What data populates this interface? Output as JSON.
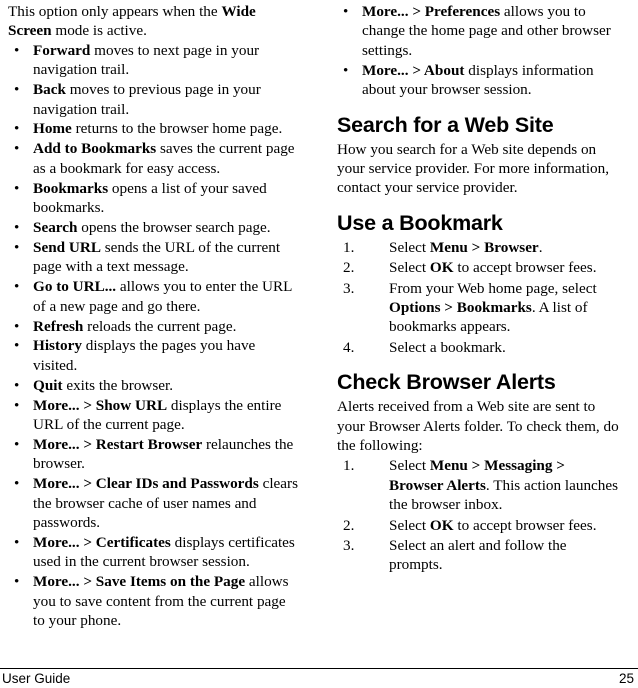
{
  "document": {
    "footer": {
      "left_label": "User Guide",
      "page_number": "25"
    }
  },
  "left_column": {
    "intro_paragraph": {
      "plain_before": "This option only appears when the ",
      "bold": "Wide Screen",
      "plain_after": " mode is active."
    },
    "bullet_marker": "•",
    "bullets": [
      {
        "term": "Forward",
        "rest": " moves to next page in your navigation trail."
      },
      {
        "term": "Back",
        "rest": " moves to previous page in your navigation trail."
      },
      {
        "term": "Home",
        "rest": " returns to the browser home page."
      },
      {
        "term": "Add to Bookmarks",
        "rest": " saves the current page as a bookmark for easy access."
      },
      {
        "term": "Bookmarks",
        "rest": " opens a list of your saved bookmarks."
      },
      {
        "term": "Search",
        "rest": " opens the browser search page."
      },
      {
        "term": "Send URL",
        "rest": " sends the URL of the current page with a text message."
      },
      {
        "term": "Go to URL...",
        "rest": " allows you to enter the URL of a new page and go there."
      },
      {
        "term": "Refresh",
        "rest": " reloads the current page."
      },
      {
        "term": "History",
        "rest": " displays the pages you have visited."
      },
      {
        "term": "Quit",
        "rest": " exits the browser."
      },
      {
        "term": "More... > Show URL",
        "rest": " displays the entire URL of the current page."
      },
      {
        "term": "More... > Restart Browser",
        "rest": " relaunches the browser."
      },
      {
        "term": "More... > Clear IDs and Passwords",
        "rest": " clears the browser cache of user names and passwords."
      },
      {
        "term": "More... > Certificates",
        "rest": " displays certificates used in the current browser session."
      },
      {
        "term": "More... > Save Items on the Page",
        "rest": " allows you to save content from the current page to your phone."
      }
    ]
  },
  "right_column": {
    "bullet_marker": "•",
    "top_bullets": [
      {
        "term": "More... > Preferences",
        "rest": " allows you to change the home page and other browser settings."
      },
      {
        "term": "More... > About",
        "rest": " displays information about your browser session."
      }
    ],
    "sections": [
      {
        "heading": "Search for a Web Site",
        "paragraph": "How you search for a Web site depends on your service provider. For more information, contact your service provider."
      },
      {
        "heading": "Use a Bookmark",
        "steps": [
          {
            "number": "1.",
            "segments": [
              {
                "text": "Select ",
                "bold": false
              },
              {
                "text": "Menu > Browser",
                "bold": true
              },
              {
                "text": ".",
                "bold": false
              }
            ]
          },
          {
            "number": "2.",
            "segments": [
              {
                "text": "Select ",
                "bold": false
              },
              {
                "text": "OK",
                "bold": true
              },
              {
                "text": " to accept browser fees.",
                "bold": false
              }
            ]
          },
          {
            "number": "3.",
            "segments": [
              {
                "text": "From your Web home page, select ",
                "bold": false
              },
              {
                "text": "Options > Bookmarks",
                "bold": true
              },
              {
                "text": ". A list of bookmarks appears.",
                "bold": false
              }
            ]
          },
          {
            "number": "4.",
            "segments": [
              {
                "text": "Select a bookmark.",
                "bold": false
              }
            ]
          }
        ]
      },
      {
        "heading": "Check Browser Alerts",
        "paragraph": "Alerts received from a Web site are sent to your Browser Alerts folder. To check them, do the following:",
        "steps": [
          {
            "number": "1.",
            "segments": [
              {
                "text": "Select ",
                "bold": false
              },
              {
                "text": "Menu > Messaging > Browser Alerts",
                "bold": true
              },
              {
                "text": ". This action launches the browser inbox.",
                "bold": false
              }
            ]
          },
          {
            "number": "2.",
            "segments": [
              {
                "text": "Select ",
                "bold": false
              },
              {
                "text": "OK",
                "bold": true
              },
              {
                "text": " to accept browser fees.",
                "bold": false
              }
            ]
          },
          {
            "number": "3.",
            "segments": [
              {
                "text": "Select an alert and follow the prompts.",
                "bold": false
              }
            ]
          }
        ]
      }
    ]
  }
}
